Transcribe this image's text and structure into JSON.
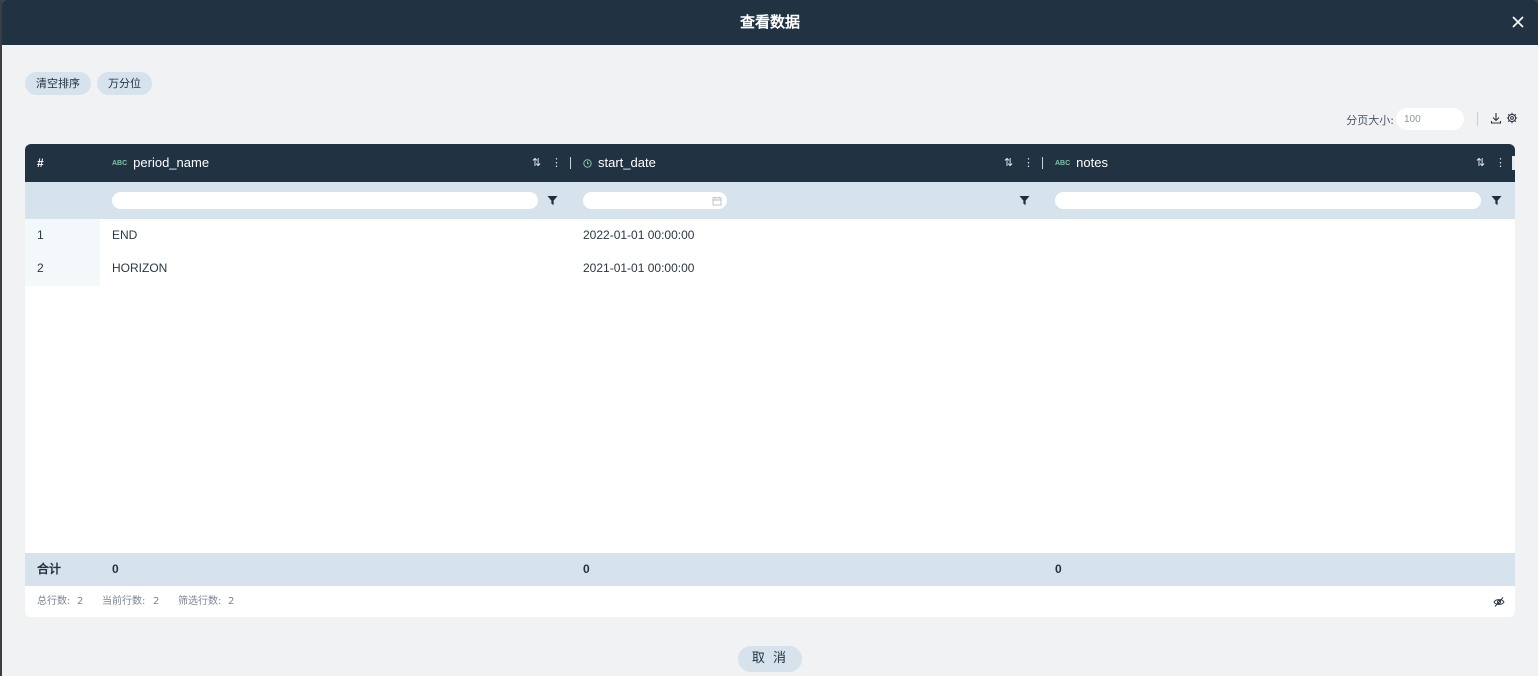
{
  "dialog": {
    "title": "查看数据",
    "close_icon": "close-icon"
  },
  "toolbar": {
    "clear_sort_label": "清空排序",
    "per_ten_thousand_label": "万分位",
    "page_size_label": "分页大小:",
    "page_size_value": "100",
    "download_icon": "download-icon",
    "settings_icon": "gear-icon"
  },
  "table": {
    "rownum_header": "#",
    "columns": [
      {
        "type_tag": "ABC",
        "name": "period_name",
        "filter_kind": "text"
      },
      {
        "type_tag": "clock",
        "name": "start_date",
        "filter_kind": "date"
      },
      {
        "type_tag": "ABC",
        "name": "notes",
        "filter_kind": "text"
      }
    ],
    "rows": [
      {
        "num": "1",
        "period_name": "END",
        "start_date": "2022-01-01 00:00:00",
        "notes": ""
      },
      {
        "num": "2",
        "period_name": "HORIZON",
        "start_date": "2021-01-01 00:00:00",
        "notes": ""
      }
    ],
    "footer": {
      "label": "合计",
      "values": [
        "0",
        "0",
        "0"
      ]
    },
    "status": {
      "total_label": "总行数:",
      "total_value": "2",
      "current_label": "当前行数:",
      "current_value": "2",
      "filtered_label": "筛选行数:",
      "filtered_value": "2"
    }
  },
  "actions": {
    "cancel_label": "取 消"
  },
  "colors": {
    "header_bg": "#213243",
    "accent_bg": "#d6e2ec",
    "type_tag": "#7fc2a8"
  }
}
